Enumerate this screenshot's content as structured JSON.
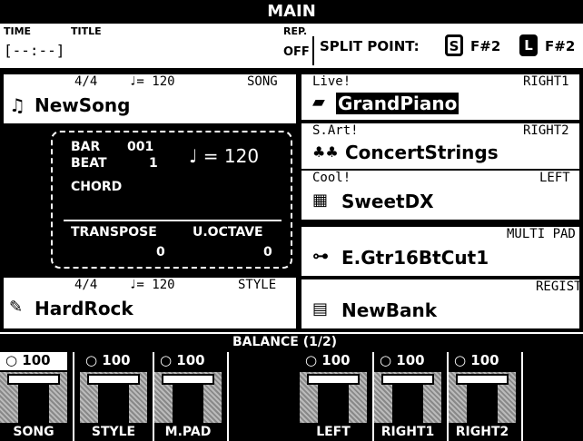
{
  "title": "MAIN",
  "info": {
    "time_label": "TIME",
    "time_value": "[--:--]",
    "title_label": "TITLE",
    "rep_label": "REP.",
    "rep_value": "OFF",
    "split_label": "SPLIT POINT:",
    "split_s": "S",
    "split_s_value": "F#2",
    "split_l": "L",
    "split_l_value": "F#2"
  },
  "song": {
    "meter": "4/4",
    "tempo": "♩= 120",
    "label": "SONG",
    "name": "NewSong"
  },
  "bar": {
    "bar_label": "BAR",
    "bar_value": "001",
    "beat_label": "BEAT",
    "beat_value": "1",
    "tempo": "♩ = 120",
    "chord_label": "CHORD",
    "transpose_label": "TRANSPOSE",
    "transpose_value": "0",
    "voctave_label": "U.OCTAVE",
    "voctave_value": "0"
  },
  "style": {
    "meter": "4/4",
    "tempo": "♩= 120",
    "label": "STYLE",
    "name": "HardRock"
  },
  "right1": {
    "cat": "Live!",
    "label": "RIGHT1",
    "name": "GrandPiano"
  },
  "right2": {
    "cat": "S.Art!",
    "label": "RIGHT2",
    "name": "ConcertStrings"
  },
  "left": {
    "cat": "Cool!",
    "label": "LEFT",
    "name": "SweetDX"
  },
  "multipad": {
    "label": "MULTI PAD",
    "name": "E.Gtr16BtCut1"
  },
  "regist": {
    "label": "REGIST",
    "name": "NewBank"
  },
  "balance": {
    "title": "BALANCE (1/2)",
    "channels": [
      {
        "name": "SONG",
        "value": "100"
      },
      {
        "name": "STYLE",
        "value": "100"
      },
      {
        "name": "M.PAD",
        "value": "100"
      },
      {
        "name": "LEFT",
        "value": "100"
      },
      {
        "name": "RIGHT1",
        "value": "100"
      },
      {
        "name": "RIGHT2",
        "value": "100"
      }
    ]
  }
}
